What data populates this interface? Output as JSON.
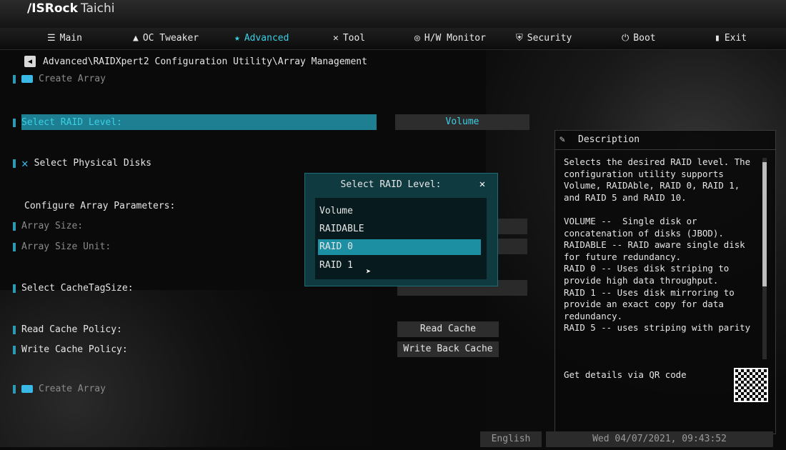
{
  "brand": {
    "name": "/ISRock",
    "model": "Taichi"
  },
  "menu": {
    "main": "Main",
    "oc_tweaker": "OC Tweaker",
    "advanced": "Advanced",
    "tool": "Tool",
    "hw_monitor": "H/W Monitor",
    "security": "Security",
    "boot": "Boot",
    "exit": "Exit"
  },
  "breadcrumb": "Advanced\\RAIDXpert2 Configuration Utility\\Array Management",
  "rows": {
    "create_array_top": "Create Array",
    "select_raid_level": "Select RAID Level:",
    "select_physical_disks": "Select Physical Disks",
    "configure_array_parameters": "Configure Array Parameters:",
    "array_size": "Array Size:",
    "array_size_unit": "Array Size Unit:",
    "select_cachetagsize": "Select CacheTagSize:",
    "read_cache_policy": "Read Cache Policy:",
    "write_cache_policy": "Write Cache Policy:",
    "create_array_bottom": "Create Array"
  },
  "values": {
    "raid_level": "Volume",
    "read_cache": "Read Cache",
    "write_cache": "Write Back Cache"
  },
  "popup": {
    "title": "Select RAID Level:",
    "options": [
      "Volume",
      "RAIDABLE",
      "RAID 0",
      "RAID 1"
    ],
    "selected": "RAID 0"
  },
  "description": {
    "title": "Description",
    "text": "Selects the desired RAID level. The configuration utility supports Volume, RAIDAble, RAID 0, RAID 1, and RAID 5 and RAID 10.\n\nVOLUME --  Single disk or concatenation of disks (JBOD).\nRAIDABLE -- RAID aware single disk for future redundancy.\nRAID 0 -- Uses disk striping to provide high data throughput.\nRAID 1 -- Uses disk mirroring to provide an exact copy for data redundancy.\nRAID 5 -- uses striping with parity",
    "qr_label": "Get details via QR code"
  },
  "footer": {
    "language": "English",
    "datetime": "Wed 04/07/2021, 09:43:52"
  }
}
